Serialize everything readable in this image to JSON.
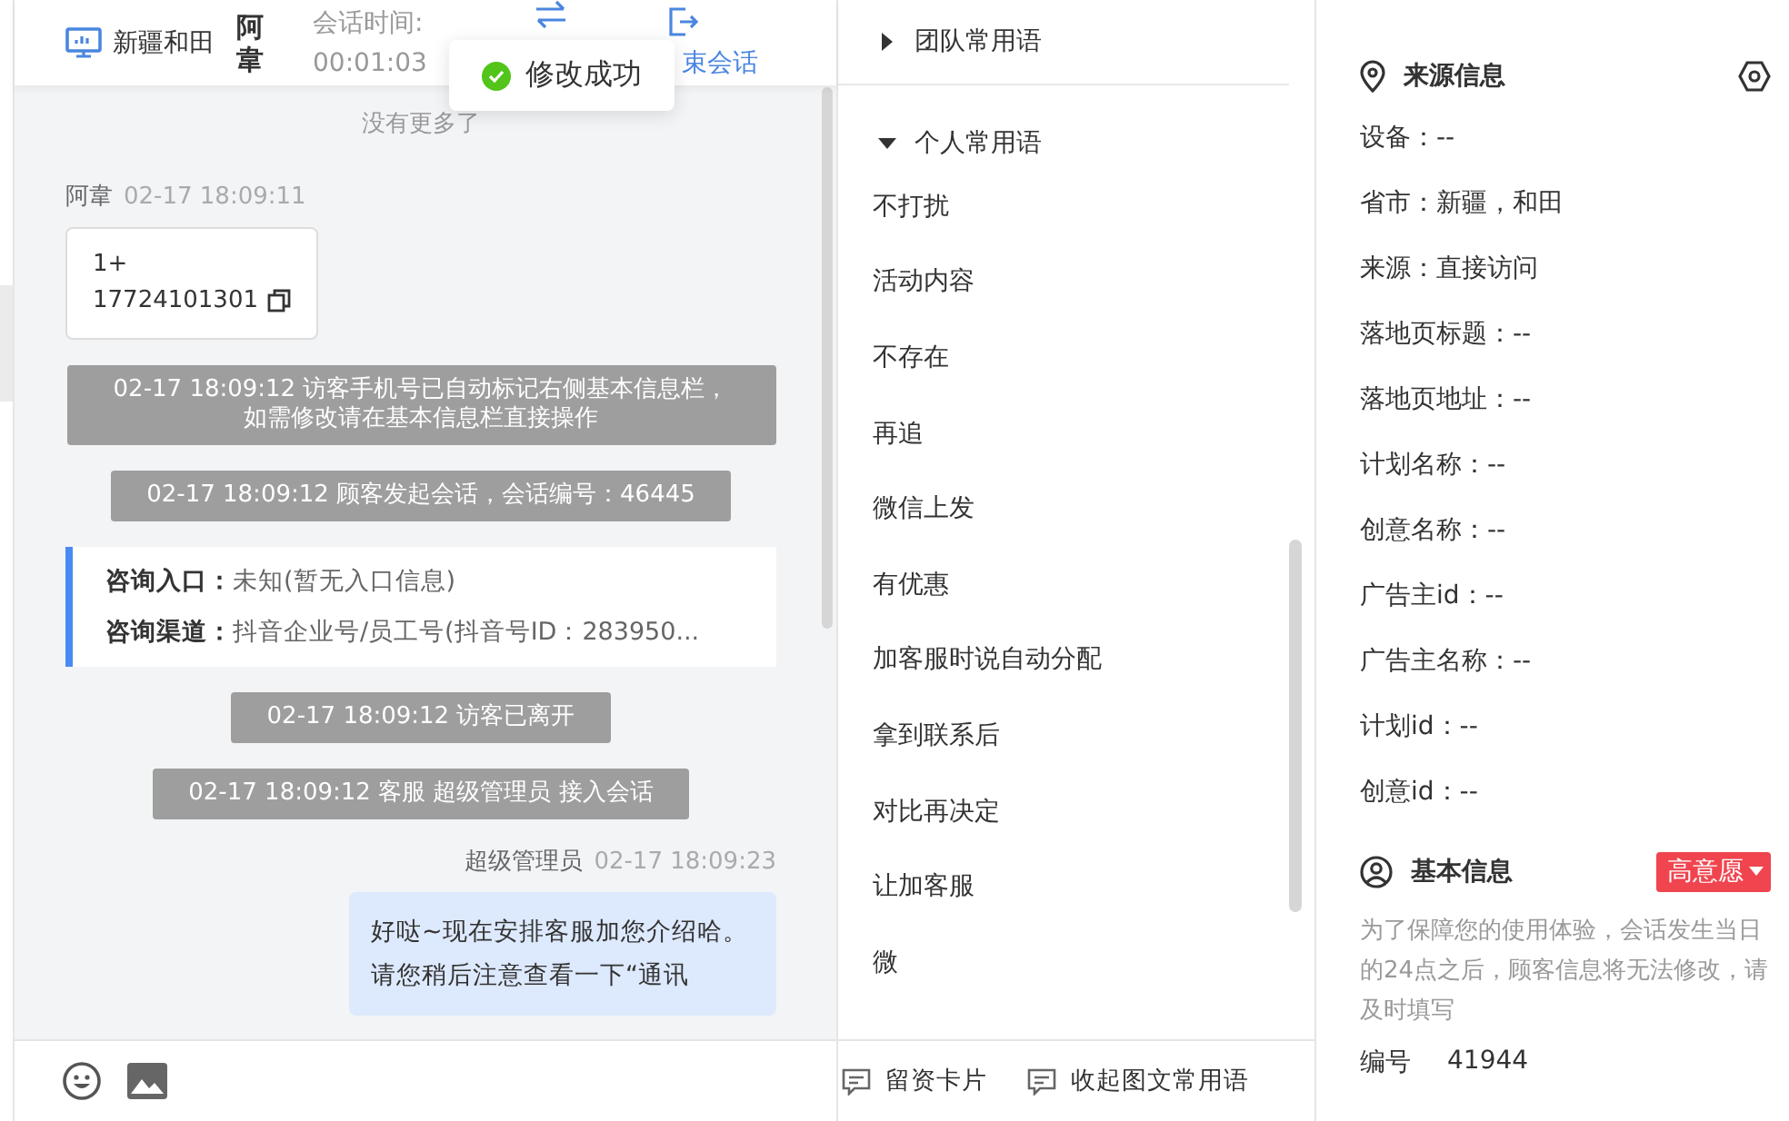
{
  "header": {
    "location": "新疆和田",
    "visitor": "阿韋",
    "session_label": "会话时间:",
    "session_time": "00:01:03",
    "end_label": "束会话"
  },
  "toast": {
    "text": "修改成功"
  },
  "chat": {
    "no_more": "没有更多了",
    "messages": [
      {
        "kind": "visitor",
        "name": "阿韋",
        "time": "02-17 18:09:11",
        "text": "1+ 17724101301"
      },
      {
        "kind": "system",
        "text": "02-17 18:09:12 访客手机号已自动标记右侧基本信息栏，如需修改请在基本信息栏直接操作"
      },
      {
        "kind": "system",
        "text": "02-17 18:09:12 顾客发起会话，会话编号：46445"
      },
      {
        "kind": "source",
        "rows": [
          {
            "label": "咨询入口：",
            "value": "未知(暂无入口信息)"
          },
          {
            "label": "咨询渠道：",
            "value": "抖音企业号/员工号(抖音号ID：283950..."
          }
        ]
      },
      {
        "kind": "system",
        "text": "02-17 18:09:12 访客已离开"
      },
      {
        "kind": "system",
        "text": "02-17 18:09:12 客服 超级管理员 接入会话"
      },
      {
        "kind": "agent",
        "name": "超级管理员",
        "time": "02-17 18:09:23",
        "text": "好哒~现在安排客服加您介绍哈。请您稍后注意查看一下“通讯"
      }
    ]
  },
  "phrases": {
    "groups": [
      {
        "title": "团队常用语",
        "expanded": false
      },
      {
        "title": "个人常用语",
        "expanded": true,
        "items": [
          "不打扰",
          "活动内容",
          "不存在",
          "再追",
          "微信上发",
          "有优惠",
          "加客服时说自动分配",
          "拿到联系后",
          "对比再决定",
          "让加客服",
          "微"
        ]
      }
    ],
    "actions": [
      "留资卡片",
      "收起图文常用语"
    ]
  },
  "source_info": {
    "title": "来源信息",
    "rows": [
      "设备：--",
      "省市：新疆，和田",
      "来源：直接访问",
      "落地页标题：--",
      "落地页地址：--",
      "计划名称：--",
      "创意名称：--",
      "广告主id：--",
      "广告主名称：--",
      "计划id：--",
      "创意id：--"
    ]
  },
  "basic_info": {
    "title": "基本信息",
    "badge": "高意愿",
    "note": "为了保障您的使用体验，会话发生当日的24点之后，顾客信息将无法修改，请及时填写",
    "fields": [
      {
        "label": "编号",
        "value": "41944"
      }
    ]
  }
}
